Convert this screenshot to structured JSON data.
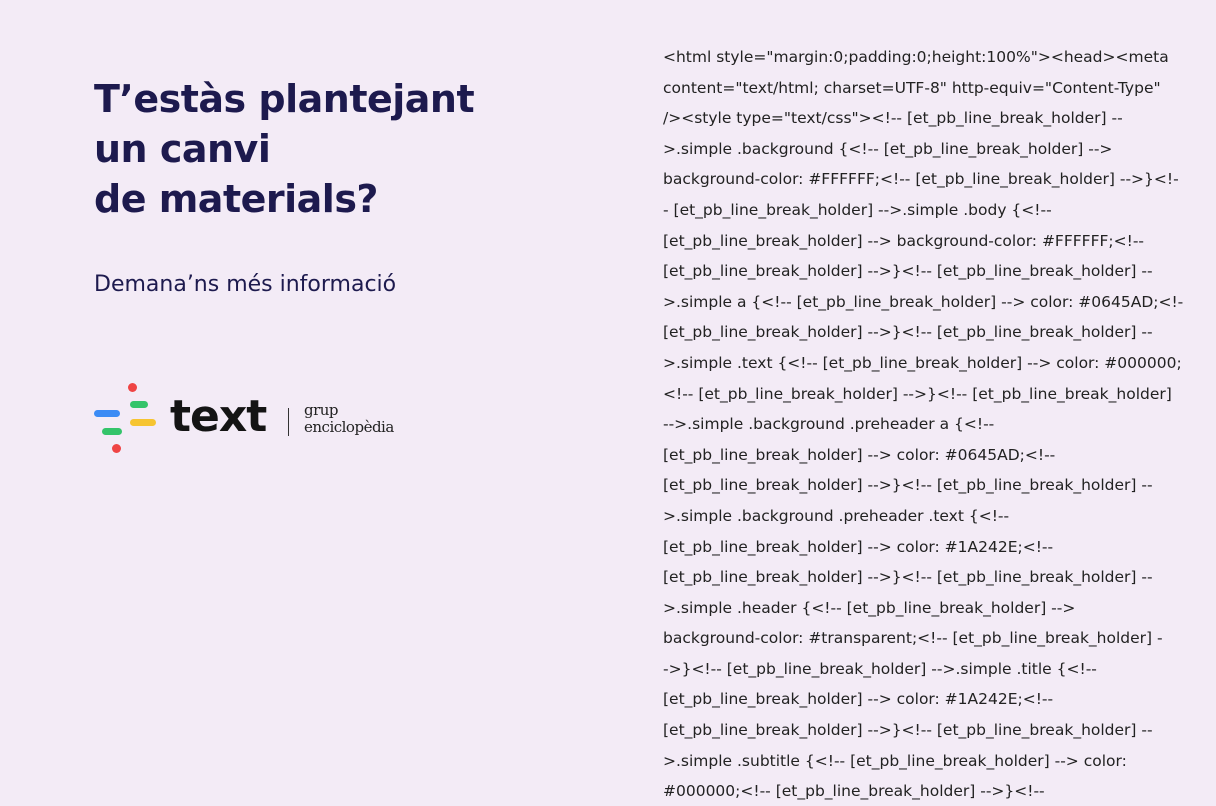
{
  "headline": {
    "line1": "T’estàs plantejant",
    "line2": "un canvi",
    "line3": "de materials?"
  },
  "subheading": "Demana’ns més informació",
  "logo": {
    "wordmark": "text",
    "sub_line1": "grup",
    "sub_line2": "enciclopèdia",
    "colors": {
      "red": "#ef4444",
      "blue": "#3b8bf5",
      "green": "#34c46a",
      "yellow": "#f6c431"
    }
  },
  "code_lines": [
    "<html style=\"margin:0;padding:0;height:100%\"><head><meta",
    "content=\"text/html; charset=UTF-8\" http-equiv=\"Content-Type\"",
    "/><style type=\"text/css\"><!-- [et_pb_line_break_holder] --",
    ">.simple .background {<!-- [et_pb_line_break_holder] -->",
    "background-color: #FFFFFF;<!-- [et_pb_line_break_holder] -->}<!-",
    "- [et_pb_line_break_holder] -->.simple .body {<!--",
    "[et_pb_line_break_holder] --> background-color: #FFFFFF;<!--",
    "[et_pb_line_break_holder] -->}<!-- [et_pb_line_break_holder] --",
    ">.simple a {<!-- [et_pb_line_break_holder] --> color: #0645AD;<!--",
    "[et_pb_line_break_holder] -->}<!-- [et_pb_line_break_holder] --",
    ">.simple .text {<!-- [et_pb_line_break_holder] --> color: #000000;",
    "<!-- [et_pb_line_break_holder] -->}<!-- [et_pb_line_break_holder]",
    "-->.simple .background .preheader a {<!--",
    "[et_pb_line_break_holder] --> color: #0645AD;<!--",
    "[et_pb_line_break_holder] -->}<!-- [et_pb_line_break_holder] --",
    ">.simple .background .preheader .text {<!--",
    "[et_pb_line_break_holder] --> color: #1A242E;<!--",
    "[et_pb_line_break_holder] -->}<!-- [et_pb_line_break_holder] --",
    ">.simple .header {<!-- [et_pb_line_break_holder] -->",
    "background-color: #transparent;<!-- [et_pb_line_break_holder] -",
    "->}<!-- [et_pb_line_break_holder] -->.simple .title {<!--",
    "[et_pb_line_break_holder] --> color: #1A242E;<!--",
    "[et_pb_line_break_holder] -->}<!-- [et_pb_line_break_holder] --",
    ">.simple .subtitle {<!-- [et_pb_line_break_holder] --> color:",
    "#000000;<!-- [et_pb_line_break_holder] -->}<!--"
  ]
}
